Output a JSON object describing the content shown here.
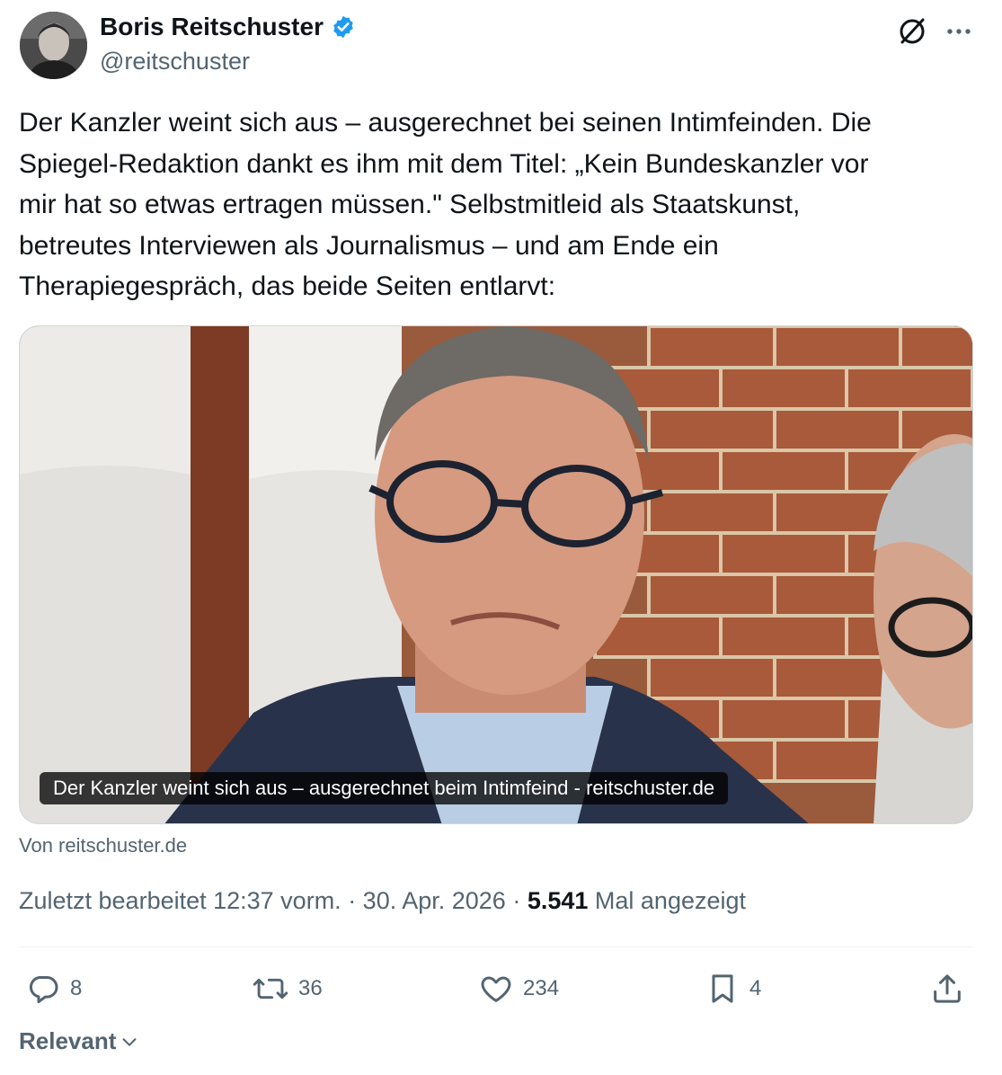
{
  "author": {
    "name": "Boris Reitschuster",
    "handle": "@reitschuster",
    "verified_color": "#1d9bf0"
  },
  "icons": {
    "header": [
      "grok-icon",
      "more-icon"
    ],
    "actions": [
      "reply-icon",
      "retweet-icon",
      "like-icon",
      "bookmark-icon",
      "share-icon"
    ]
  },
  "tweet": {
    "text": "Der Kanzler weint sich aus – ausgerechnet bei seinen Intimfeinden. Die\nSpiegel-Redaktion dankt es ihm mit dem Titel: „Kein Bundeskanzler vor\nmir hat so etwas ertragen müssen.\" Selbstmitleid als Staatskunst,\nbetreutes Interviewen als Journalismus – und am Ende ein\nTherapiegespräch, das beide Seiten entlarvt:"
  },
  "card": {
    "caption": "Der Kanzler weint sich aus – ausgerechnet beim Intimfeind - reitschuster.de",
    "source": "Von reitschuster.de"
  },
  "meta": {
    "edited_prefix": "Zuletzt bearbeitet 12:37 vorm. · 30. Apr. 2026 · ",
    "views": "5.541",
    "views_suffix": " Mal angezeigt"
  },
  "actions": {
    "replies": "8",
    "retweets": "36",
    "likes": "234",
    "bookmarks": "4"
  },
  "sort": {
    "label": "Relevant"
  }
}
